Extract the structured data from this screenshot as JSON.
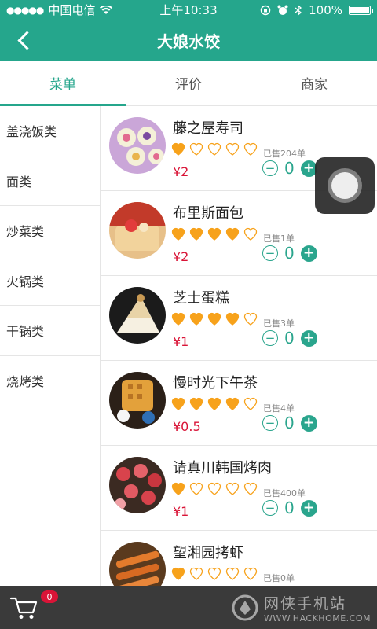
{
  "status_bar": {
    "carrier": "中国电信",
    "time": "上午10:33",
    "battery": "100%"
  },
  "nav": {
    "title": "大娘水饺"
  },
  "tabs": [
    {
      "label": "菜单",
      "active": true
    },
    {
      "label": "评价",
      "active": false
    },
    {
      "label": "商家",
      "active": false
    }
  ],
  "categories": [
    {
      "label": "盖浇饭类"
    },
    {
      "label": "面类"
    },
    {
      "label": "炒菜类"
    },
    {
      "label": "火锅类"
    },
    {
      "label": "干锅类"
    },
    {
      "label": "烧烤类"
    }
  ],
  "items": [
    {
      "name": "藤之屋寿司",
      "rating": 1,
      "sold": "已售204单",
      "price": "¥2",
      "qty": "0"
    },
    {
      "name": "布里斯面包",
      "rating": 4,
      "sold": "已售1单",
      "price": "¥2",
      "qty": "0"
    },
    {
      "name": "芝士蛋糕",
      "rating": 4,
      "sold": "已售3单",
      "price": "¥1",
      "qty": "0"
    },
    {
      "name": "慢时光下午茶",
      "rating": 4,
      "sold": "已售4单",
      "price": "¥0.5",
      "qty": "0"
    },
    {
      "name": "请真川韩国烤肉",
      "rating": 1,
      "sold": "已售400单",
      "price": "¥1",
      "qty": "0"
    },
    {
      "name": "望湘园拷虾",
      "rating": 1,
      "sold": "已售0单",
      "price": "",
      "qty": ""
    }
  ],
  "cart": {
    "count": "0",
    "icon": "cart-icon"
  },
  "watermark": {
    "brand": "网侠手机站",
    "url": "WWW.HACKHOME.COM"
  },
  "colors": {
    "primary": "#25a68c",
    "price": "#d91437",
    "heart": "#f7a21b",
    "bottom_bar": "#3a3a3a"
  }
}
